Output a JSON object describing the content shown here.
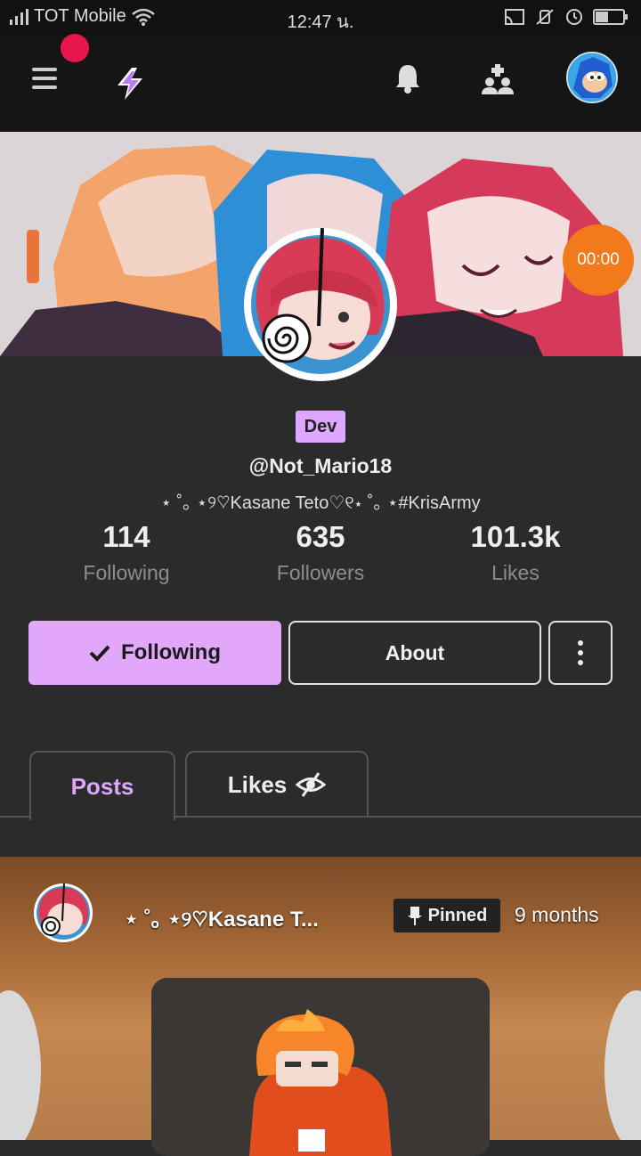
{
  "status_bar": {
    "carrier": "TOT Mobile",
    "time": "12:47 น."
  },
  "timer": "00:00",
  "profile": {
    "badge": "Dev",
    "handle": "@Not_Mario18",
    "bio": "⋆ ˚｡ ⋆୨♡Kasane Teto♡୧⋆ ˚｡ ⋆#KrisArmy",
    "stats": [
      {
        "value": "114",
        "label": "Following"
      },
      {
        "value": "635",
        "label": "Followers"
      },
      {
        "value": "101.3k",
        "label": "Likes"
      }
    ]
  },
  "actions": {
    "following": "Following",
    "about": "About"
  },
  "tabs": {
    "posts": "Posts",
    "likes": "Likes"
  },
  "post": {
    "author": "⋆ ˚｡ ⋆୨♡Kasane T...",
    "pinned": "Pinned",
    "time": "9 months"
  },
  "colors": {
    "accent": "#dda6ff",
    "timer": "#f27a1a",
    "notification": "#e6154b"
  }
}
